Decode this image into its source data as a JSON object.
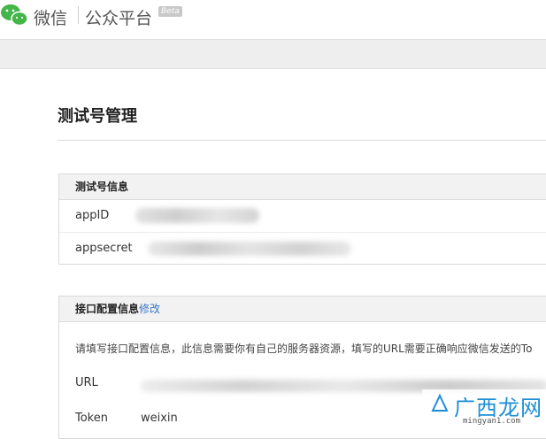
{
  "header": {
    "brand": "微信",
    "platform": "公众平台",
    "badge": "Beta",
    "colors": {
      "logo": "#43b549"
    }
  },
  "page": {
    "title": "测试号管理"
  },
  "test_info": {
    "heading": "测试号信息",
    "rows": [
      {
        "label": "appID",
        "value_hidden": true
      },
      {
        "label": "appsecret",
        "value_hidden": true
      }
    ]
  },
  "interface_config": {
    "heading": "接口配置信息",
    "edit_link": "修改",
    "description": "请填写接口配置信息，此信息需要你有自己的服务器资源，填写的URL需要正确响应微信发送的To",
    "fields": {
      "url_label": "URL",
      "token_label": "Token",
      "token_value": "weixin"
    }
  },
  "watermark": {
    "text": "广西龙网",
    "url": "mingyan1.com"
  }
}
